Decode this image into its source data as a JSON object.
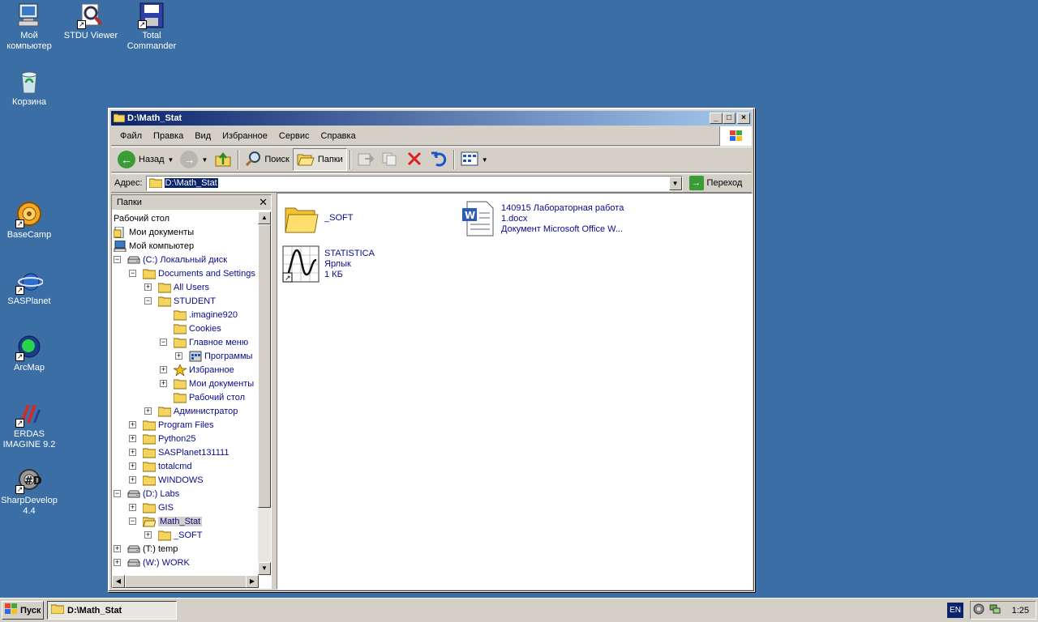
{
  "desktop": {
    "icons": [
      {
        "label": "Мой компьютер",
        "icon": "computer-icon"
      },
      {
        "label": "STDU Viewer",
        "icon": "stdu-viewer-icon"
      },
      {
        "label": "Total Commander",
        "icon": "floppy-icon"
      },
      {
        "label": "Корзина",
        "icon": "recycle-bin-icon"
      },
      {
        "label": "BaseCamp",
        "icon": "basecamp-icon"
      },
      {
        "label": "SASPlanet",
        "icon": "sasplanet-icon"
      },
      {
        "label": "ArcMap",
        "icon": "arcmap-icon"
      },
      {
        "label": "ERDAS IMAGINE 9.2",
        "icon": "erdas-icon"
      },
      {
        "label": "SharpDevelop 4.4",
        "icon": "sharpdevelop-icon"
      }
    ]
  },
  "window": {
    "title": "D:\\Math_Stat",
    "menu": [
      "Файл",
      "Правка",
      "Вид",
      "Избранное",
      "Сервис",
      "Справка"
    ],
    "toolbar": {
      "back_label": "Назад",
      "search_label": "Поиск",
      "folders_label": "Папки"
    },
    "address": {
      "label": "Адрес:",
      "value": "D:\\Math_Stat",
      "go_label": "Переход"
    },
    "folders_pane": {
      "title": "Папки",
      "tree": [
        {
          "label": "Рабочий стол",
          "level": 0,
          "expander": "",
          "icon": "none",
          "color": "black"
        },
        {
          "label": "Мои документы",
          "level": 0,
          "expander": "",
          "icon": "mydocs",
          "color": "black"
        },
        {
          "label": "Мой компьютер",
          "level": 0,
          "expander": "",
          "icon": "computer",
          "color": "black"
        },
        {
          "label": "(C:) Локальный диск",
          "level": 0,
          "expander": "−",
          "icon": "drive",
          "color": "blue"
        },
        {
          "label": "Documents and Settings",
          "level": 1,
          "expander": "−",
          "icon": "folder",
          "color": "blue"
        },
        {
          "label": "All Users",
          "level": 2,
          "expander": "+",
          "icon": "folder",
          "color": "blue"
        },
        {
          "label": "STUDENT",
          "level": 2,
          "expander": "−",
          "icon": "folder",
          "color": "blue"
        },
        {
          "label": ".imagine920",
          "level": 3,
          "expander": "",
          "icon": "folder",
          "color": "blue"
        },
        {
          "label": "Cookies",
          "level": 3,
          "expander": "",
          "icon": "folder",
          "color": "blue"
        },
        {
          "label": "Главное меню",
          "level": 3,
          "expander": "−",
          "icon": "folder",
          "color": "blue"
        },
        {
          "label": "Программы",
          "level": 4,
          "expander": "+",
          "icon": "programs",
          "color": "blue"
        },
        {
          "label": "Избранное",
          "level": 3,
          "expander": "+",
          "icon": "star",
          "color": "blue"
        },
        {
          "label": "Мои документы",
          "level": 3,
          "expander": "+",
          "icon": "folder",
          "color": "blue"
        },
        {
          "label": "Рабочий стол",
          "level": 3,
          "expander": "",
          "icon": "folder",
          "color": "blue"
        },
        {
          "label": "Администратор",
          "level": 2,
          "expander": "+",
          "icon": "folder",
          "color": "blue"
        },
        {
          "label": "Program Files",
          "level": 1,
          "expander": "+",
          "icon": "folder",
          "color": "blue"
        },
        {
          "label": "Python25",
          "level": 1,
          "expander": "+",
          "icon": "folder",
          "color": "blue"
        },
        {
          "label": "SASPlanet131111",
          "level": 1,
          "expander": "+",
          "icon": "folder",
          "color": "blue"
        },
        {
          "label": "totalcmd",
          "level": 1,
          "expander": "+",
          "icon": "folder",
          "color": "blue"
        },
        {
          "label": "WINDOWS",
          "level": 1,
          "expander": "+",
          "icon": "folder",
          "color": "blue"
        },
        {
          "label": "(D:) Labs",
          "level": 0,
          "expander": "−",
          "icon": "drive",
          "color": "blue"
        },
        {
          "label": "GIS",
          "level": 1,
          "expander": "+",
          "icon": "folder",
          "color": "blue"
        },
        {
          "label": "Math_Stat",
          "level": 1,
          "expander": "−",
          "icon": "folder-open",
          "color": "blue",
          "selected": true
        },
        {
          "label": "_SOFT",
          "level": 2,
          "expander": "+",
          "icon": "folder",
          "color": "blue"
        },
        {
          "label": "(T:) temp",
          "level": 0,
          "expander": "+",
          "icon": "drive",
          "color": "black"
        },
        {
          "label": "(W:) WORK",
          "level": 0,
          "expander": "+",
          "icon": "drive",
          "color": "blue"
        }
      ]
    },
    "files": [
      {
        "lines": [
          "_SOFT"
        ],
        "icon": "folder-large-icon"
      },
      {
        "lines": [
          "140915 Лабораторная работа",
          "1.docx",
          "Документ Microsoft Office W..."
        ],
        "icon": "word-document-icon"
      },
      {
        "lines": [
          "STATISTICA",
          "Ярлык",
          "1 КБ"
        ],
        "icon": "statistica-icon"
      }
    ]
  },
  "taskbar": {
    "start_label": "Пуск",
    "task_label": "D:\\Math_Stat",
    "lang": "EN",
    "clock": "1:25"
  }
}
